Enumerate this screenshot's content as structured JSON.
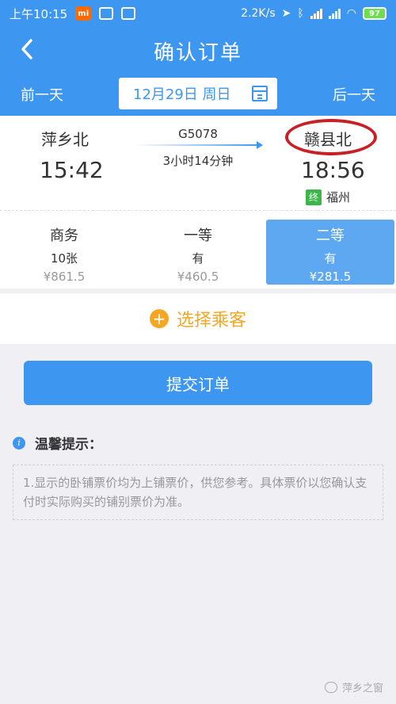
{
  "status_bar": {
    "time": "上午10:15",
    "network_speed": "2.2K/s",
    "battery": "97"
  },
  "header": {
    "title": "确认订单"
  },
  "date_bar": {
    "prev_label": "前一天",
    "date": "12月29日 周日",
    "next_label": "后一天"
  },
  "train": {
    "departure_station": "萍乡北",
    "departure_time": "15:42",
    "train_number": "G5078",
    "duration": "3小时14分钟",
    "arrival_station": "赣县北",
    "arrival_time": "18:56",
    "terminal_badge": "终",
    "terminal_station": "福州"
  },
  "seats": [
    {
      "name": "商务",
      "availability": "10张",
      "price": "¥861.5"
    },
    {
      "name": "一等",
      "availability": "有",
      "price": "¥460.5"
    },
    {
      "name": "二等",
      "availability": "有",
      "price": "¥281.5"
    }
  ],
  "passenger": {
    "label": "选择乘客"
  },
  "submit": {
    "label": "提交订单"
  },
  "tips": {
    "title": "温馨提示：",
    "text": "1.显示的卧铺票价均为上铺票价，供您参考。具体票价以您确认支付时实际购买的铺别票价为准。"
  },
  "watermark": {
    "text": "萍乡之窗"
  },
  "colors": {
    "primary": "#3d97f0",
    "selected_seat": "#5ea8f1",
    "accent_orange": "#f5a623",
    "highlight_circle": "#c62127",
    "terminal_green": "#3cb54a"
  }
}
